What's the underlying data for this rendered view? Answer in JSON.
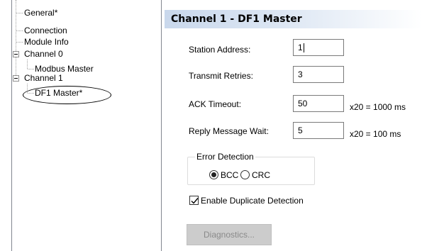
{
  "tree": {
    "items": [
      {
        "label": "General*"
      },
      {
        "label": "Connection"
      },
      {
        "label": "Module Info"
      },
      {
        "label": "Channel 0"
      },
      {
        "label": "Modbus Master"
      },
      {
        "label": "Channel 1"
      },
      {
        "label": "DF1 Master*"
      }
    ]
  },
  "panel": {
    "title": "Channel 1 - DF1 Master",
    "fields": [
      {
        "label": "Station Address:",
        "value": "1",
        "suffix": ""
      },
      {
        "label": "Transmit Retries:",
        "value": "3",
        "suffix": ""
      },
      {
        "label": "ACK Timeout:",
        "value": "50",
        "suffix": "x20 =  1000 ms"
      },
      {
        "label": "Reply Message Wait:",
        "value": "5",
        "suffix": "x20 =  100 ms"
      }
    ],
    "error_detection": {
      "title": "Error Detection",
      "options": [
        "BCC",
        "CRC"
      ],
      "selected": "BCC"
    },
    "duplicate_detection": {
      "label": "Enable Duplicate Detection",
      "checked": true
    },
    "diagnostics_button": "Diagnostics..."
  }
}
